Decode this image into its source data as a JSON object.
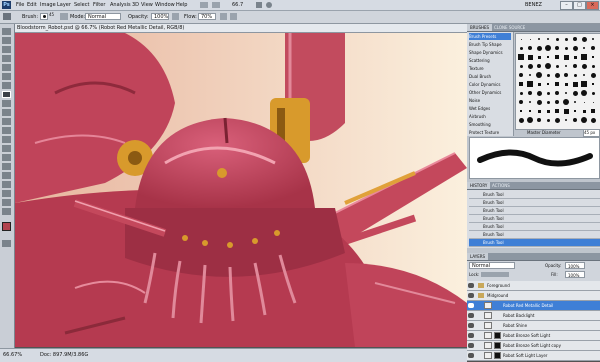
{
  "app": {
    "logo": "Ps",
    "zoom": "66.7"
  },
  "menu": [
    "File",
    "Edit",
    "Image",
    "Layer",
    "Select",
    "Filter",
    "Analysis",
    "3D",
    "View",
    "Window",
    "Help"
  ],
  "workspace": "BENEZ",
  "options": {
    "tool_label": "Brush:",
    "brush_size": "45",
    "mode_label": "Mode:",
    "mode_value": "Normal",
    "opacity_label": "Opacity:",
    "opacity_value": "100%",
    "flow_label": "Flow:",
    "flow_value": "70%"
  },
  "document": {
    "title": "Bloodstorm_Robot.psd @ 66.7% (Robot Red Metallic Detail, RGB/8)"
  },
  "status": {
    "zoom": "66.67%",
    "doc_size": "Doc: 897.9M/3.86G"
  },
  "brushes_panel": {
    "tabs": [
      "BRUSHES",
      "CLONE SOURCE"
    ],
    "options": [
      "Brush Presets",
      "Brush Tip Shape",
      "Shape Dynamics",
      "Scattering",
      "Texture",
      "Dual Brush",
      "Color Dynamics",
      "Other Dynamics",
      "Noise",
      "Wet Edges",
      "Airbrush",
      "Smoothing",
      "Protect Texture"
    ],
    "master_diameter_label": "Master Diameter",
    "master_diameter_value": "45 px"
  },
  "history_panel": {
    "tabs": [
      "HISTORY",
      "ACTIONS"
    ],
    "items": [
      "Brush Tool",
      "Brush Tool",
      "Brush Tool",
      "Brush Tool",
      "Brush Tool",
      "Brush Tool",
      "Brush Tool"
    ]
  },
  "layers_panel": {
    "tab": "LAYERS",
    "blend_mode": "Normal",
    "opacity_label": "Opacity:",
    "opacity_value": "100%",
    "lock_label": "Lock:",
    "fill_label": "Fill:",
    "fill_value": "100%",
    "layers": [
      "Foreground",
      "Midground",
      "Robot Red Metallic Detail",
      "Robot Backlight",
      "Robot Shine",
      "Robot Bronze Soft Light",
      "Robot Bronze Soft Light copy",
      "Robot Soft Light Layer"
    ]
  },
  "colors": {
    "accent": "#3f7fd6",
    "robot_red": "#c9445a",
    "bronze": "#d89a2c"
  }
}
